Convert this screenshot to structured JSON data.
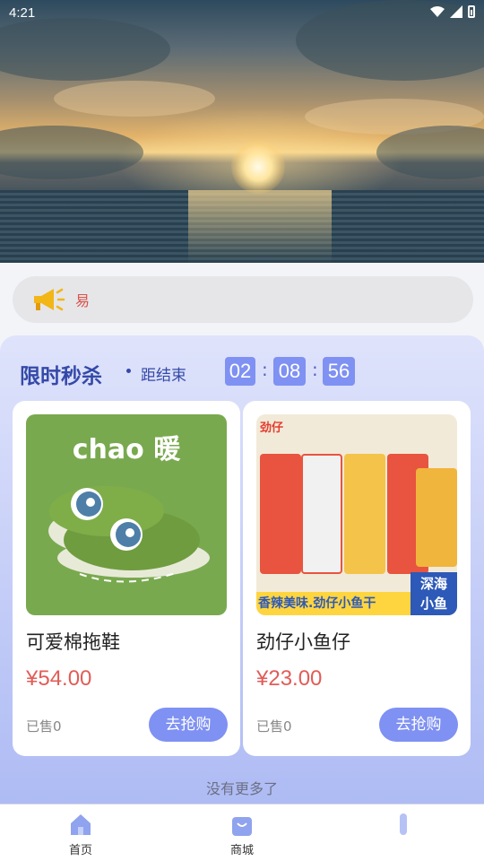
{
  "status_bar": {
    "time": "4:21"
  },
  "notice": {
    "text": "易"
  },
  "flash_sale": {
    "title": "限时秒杀",
    "ends_label": "距结束",
    "countdown": {
      "hours": "02",
      "minutes": "08",
      "seconds": "56"
    }
  },
  "products": [
    {
      "name": "可爱棉拖鞋",
      "price": "¥54.00",
      "sold": "已售0",
      "buy_label": "去抢购",
      "image_text": "chao 暖"
    },
    {
      "name": "劲仔小鱼仔",
      "price": "¥23.00",
      "sold": "已售0",
      "buy_label": "去抢购",
      "image_text": {
        "logo": "劲仔",
        "banner": "香辣美味.劲仔小鱼干",
        "badge_top": "深海",
        "badge_bottom": "小鱼"
      }
    }
  ],
  "list_footer": "没有更多了",
  "tabs": [
    {
      "label": "首页",
      "icon": "home-icon"
    },
    {
      "label": "商城",
      "icon": "shopping-bag-icon"
    },
    {
      "label": "",
      "icon": "profile-icon"
    }
  ],
  "colors": {
    "accent": "#7f91f2",
    "title": "#3449a8",
    "price": "#e25c57",
    "notice_text": "#d9534a"
  }
}
